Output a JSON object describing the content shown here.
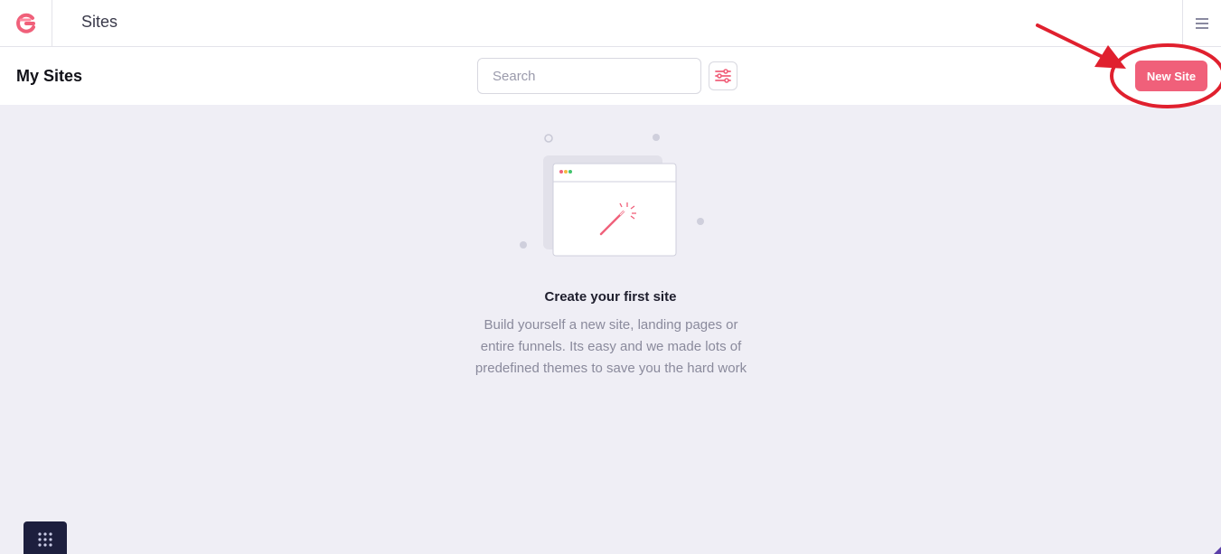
{
  "header": {
    "app_title": "Sites",
    "logo_icon": "g-logo-icon",
    "menu_icon": "hamburger-menu-icon"
  },
  "toolbar": {
    "page_title": "My Sites",
    "search_placeholder": "Search",
    "search_value": "",
    "filter_icon": "sliders-icon",
    "new_site_label": "New Site"
  },
  "empty_state": {
    "title": "Create your first site",
    "description": "Build yourself a new site, landing pages or entire funnels. Its easy and we made lots of predefined themes to save you the hard work",
    "illustration_icon": "magic-wand-browser-icon"
  },
  "footer": {
    "launcher_icon": "grid-dots-icon"
  },
  "colors": {
    "accent": "#f0607a",
    "annotation": "#e0202e",
    "background": "#efeef5",
    "launcher": "#1d1f3e"
  }
}
